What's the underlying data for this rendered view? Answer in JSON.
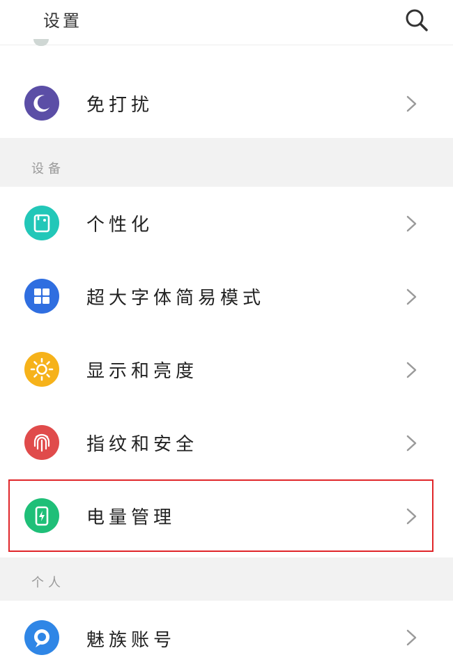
{
  "header": {
    "title": "设置",
    "search_icon": "search-icon"
  },
  "rows_top": [
    {
      "label": "免打扰",
      "icon": "moon-icon",
      "color": "#5b4ea6"
    }
  ],
  "sections": {
    "device": "设备",
    "personal": "个人"
  },
  "device_items": [
    {
      "label": "个性化",
      "icon": "personalize-icon",
      "color": "#22c7b8"
    },
    {
      "label": "超大字体简易模式",
      "icon": "grid-icon",
      "color": "#2f6ee0"
    },
    {
      "label": "显示和亮度",
      "icon": "sun-icon",
      "color": "#f6b21a"
    },
    {
      "label": "指纹和安全",
      "icon": "fingerprint-icon",
      "color": "#e04b4b"
    },
    {
      "label": "电量管理",
      "icon": "battery-icon",
      "color": "#1fbf78",
      "highlighted": true
    }
  ],
  "personal_items": [
    {
      "label": "魅族账号",
      "icon": "account-icon",
      "color": "#2f86e6"
    }
  ],
  "colors": {
    "section_bg": "#f2f2f2",
    "highlight_border": "#e0262a"
  }
}
